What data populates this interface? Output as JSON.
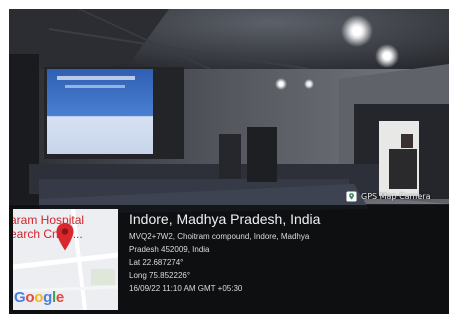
{
  "badge": {
    "icon": "map-marker-square-icon",
    "label": "GPS Map Camera"
  },
  "map": {
    "place_line1": "aram Hospital",
    "place_line2": "earch Cntre...",
    "pin_icon": "map-pin-icon",
    "logo_text": "Google",
    "pin_color": "#d8282e"
  },
  "location": {
    "title": "Indore, Madhya Pradesh, India",
    "address_line1": "MVQ2+7W2, Choitram compound, Indore, Madhya",
    "address_line2": "Pradesh 452009, India",
    "lat": "Lat 22.687274°",
    "long": "Long 75.852226°",
    "datetime": "16/09/22 11:10 AM GMT +05:30"
  }
}
